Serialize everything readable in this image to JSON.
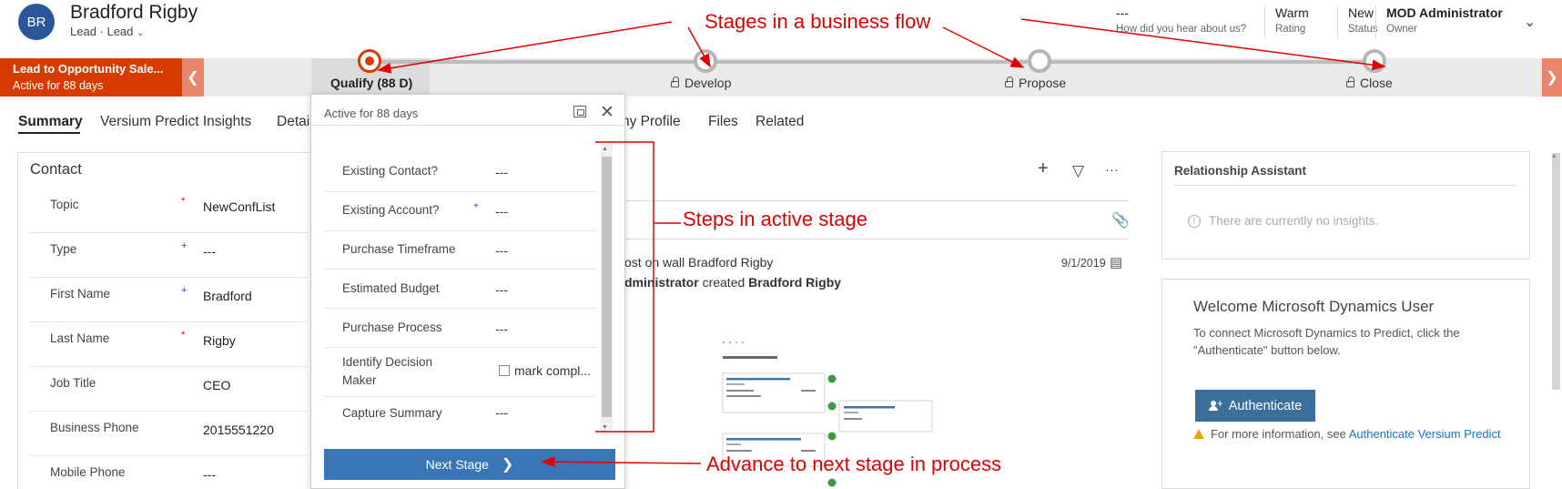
{
  "record": {
    "initials": "BR",
    "name": "Bradford Rigby",
    "type_line": "Lead · Lead"
  },
  "header_fields": {
    "hear_about": {
      "value": "---",
      "label": "How did you hear about us?"
    },
    "rating": {
      "value": "Warm",
      "label": "Rating"
    },
    "status": {
      "value": "New",
      "label": "Status"
    },
    "owner": {
      "value": "MOD Administrator",
      "label": "Owner"
    }
  },
  "process": {
    "name": "Lead to Opportunity Sale...",
    "active_for": "Active for 88 days",
    "stages": [
      {
        "label": "Qualify  (88 D)",
        "active": true
      },
      {
        "label": "Develop",
        "active": false
      },
      {
        "label": "Propose",
        "active": false
      },
      {
        "label": "Close",
        "active": false
      }
    ]
  },
  "tabs": [
    "Summary",
    "Versium Predict Insights",
    "Detai",
    "ny Profile",
    "Files",
    "Related"
  ],
  "contact": {
    "title": "Contact",
    "fields": [
      {
        "label": "Topic",
        "marker": "*",
        "value": "NewConfList"
      },
      {
        "label": "Type",
        "marker": "+",
        "value": "---"
      },
      {
        "label": "First Name",
        "marker": "+",
        "value": "Bradford"
      },
      {
        "label": "Last Name",
        "marker": "*",
        "value": "Rigby"
      },
      {
        "label": "Job Title",
        "marker": "",
        "value": "CEO"
      },
      {
        "label": "Business Phone",
        "marker": "",
        "value": "2015551220"
      },
      {
        "label": "Mobile Phone",
        "marker": "",
        "value": "---"
      }
    ]
  },
  "flyout": {
    "header": "Active for 88 days",
    "steps": [
      {
        "label": "Existing Contact?",
        "value": "---"
      },
      {
        "label": "Existing Account?",
        "marker": "+",
        "value": "---"
      },
      {
        "label": "Purchase Timeframe",
        "value": "---"
      },
      {
        "label": "Estimated Budget",
        "value": "---"
      },
      {
        "label": "Purchase Process",
        "value": "---"
      },
      {
        "label": "Identify Decision Maker",
        "checkbox_label": "mark compl..."
      },
      {
        "label": "Capture Summary",
        "value": "---"
      }
    ],
    "next_button": "Next Stage"
  },
  "timeline": {
    "post_line": "ost on wall Bradford Rigby",
    "created_pre": "dministrator",
    "created_mid": " created ",
    "created_post": "Bradford Rigby",
    "date": "9/1/2019",
    "ellipsis": "···"
  },
  "relationship_assistant": {
    "title": "Relationship Assistant",
    "empty": "There are currently no insights."
  },
  "versium": {
    "title": "Welcome Microsoft Dynamics User",
    "description": "To connect Microsoft Dynamics to Predict, click the \"Authenticate\" button below.",
    "button": "Authenticate",
    "more_pre": "For more information, see ",
    "more_link": "Authenticate Versium Predict"
  },
  "annotations": {
    "stages": "Stages in a business flow",
    "steps": "Steps in active stage",
    "advance": "Advance to next stage in process"
  },
  "colors": {
    "process_accent": "#d83b01",
    "annotation": "#e00000",
    "primary_button": "#3a76b5"
  }
}
